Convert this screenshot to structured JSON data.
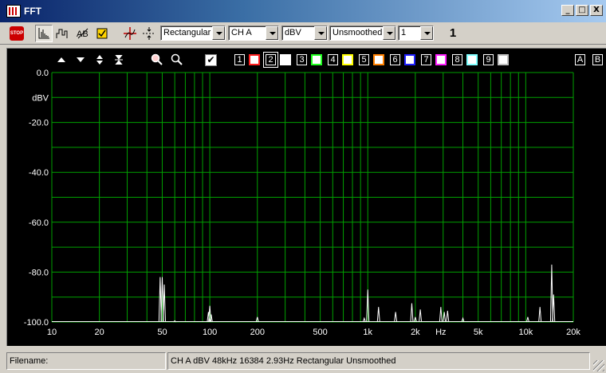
{
  "window": {
    "title": "FFT",
    "buttons": [
      "_",
      "□",
      "X"
    ]
  },
  "toolbar": {
    "stop_label": "STOP",
    "icons": [
      "stop-icon",
      "spectrum-icon",
      "waveform-icon",
      "ab-compare-icon",
      "checklist-icon",
      "cursor-crosshair-icon",
      "peak-marker-icon"
    ],
    "window_type": "Rectangular",
    "channel": "CH A",
    "units": "dBV",
    "smoothing": "Unsmoothed",
    "averages": "1",
    "average_count": "1"
  },
  "trace_bar": {
    "arrows": [
      "move-up-icon",
      "move-down-icon",
      "expand-icon",
      "contract-icon"
    ],
    "zoom_icons": [
      "zoom-in-icon",
      "zoom-out-icon"
    ],
    "traces": [
      {
        "num": "1",
        "color": "#ff2020"
      },
      {
        "num": "2",
        "color": "#ffffff"
      },
      {
        "num": "3",
        "color": "#20ff20"
      },
      {
        "num": "4",
        "color": "#ffff00"
      },
      {
        "num": "5",
        "color": "#ff8000"
      },
      {
        "num": "6",
        "color": "#2020ff"
      },
      {
        "num": "7",
        "color": "#ff20ff"
      },
      {
        "num": "8",
        "color": "#80ffff"
      },
      {
        "num": "9",
        "color": "#c0c0c0"
      }
    ],
    "extra": [
      "A",
      "B"
    ]
  },
  "chart_data": {
    "type": "line",
    "title": "",
    "xlabel": "Hz",
    "ylabel": "dBV",
    "xscale": "log",
    "xlim": [
      10,
      20000
    ],
    "ylim": [
      -100,
      0
    ],
    "y_ticks": [
      "0.0",
      "dBV",
      "-20.0",
      "-40.0",
      "-60.0",
      "-80.0",
      "-100.0"
    ],
    "x_ticks": [
      "10",
      "20",
      "50",
      "100",
      "200",
      "500",
      "1k",
      "2k",
      "5k",
      "10k",
      "20k"
    ],
    "grid": true,
    "grid_color": "#00a000",
    "trace_color": "#ffffff",
    "series": [
      {
        "values": [
          {
            "x": 48.5,
            "y": -82
          },
          {
            "x": 50,
            "y": -82
          },
          {
            "x": 51.5,
            "y": -85
          },
          {
            "x": 60,
            "y": -99.5
          },
          {
            "x": 98,
            "y": -96
          },
          {
            "x": 100,
            "y": -93.5
          },
          {
            "x": 102,
            "y": -97
          },
          {
            "x": 200,
            "y": -98
          },
          {
            "x": 950,
            "y": -98.5
          },
          {
            "x": 1000,
            "y": -87
          },
          {
            "x": 1170,
            "y": -94
          },
          {
            "x": 1500,
            "y": -96
          },
          {
            "x": 1900,
            "y": -92.5
          },
          {
            "x": 2000,
            "y": -98
          },
          {
            "x": 2150,
            "y": -95
          },
          {
            "x": 2900,
            "y": -94
          },
          {
            "x": 3050,
            "y": -96
          },
          {
            "x": 3200,
            "y": -95.5
          },
          {
            "x": 4000,
            "y": -98.5
          },
          {
            "x": 10300,
            "y": -98
          },
          {
            "x": 12300,
            "y": -94
          },
          {
            "x": 14600,
            "y": -77
          },
          {
            "x": 15000,
            "y": -89
          }
        ]
      }
    ]
  },
  "status": {
    "filename_label": "Filename:",
    "summary": "CH A   dBV   48kHz   16384   2.93Hz   Rectangular   Unsmoothed"
  }
}
